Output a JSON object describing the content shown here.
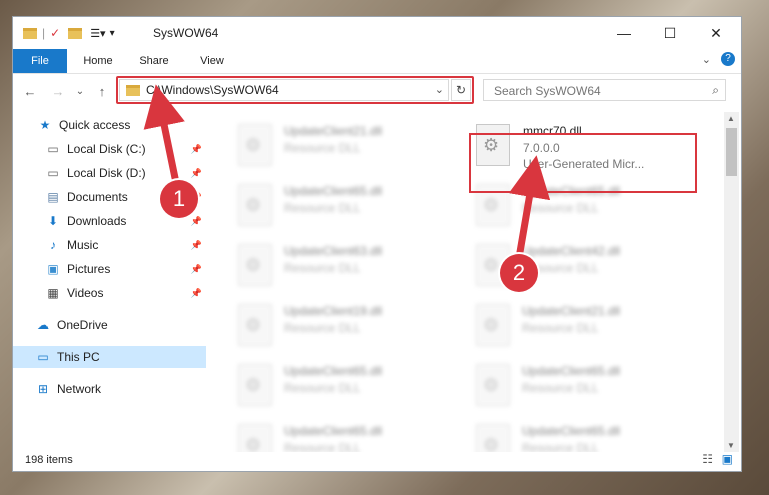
{
  "window": {
    "title": "SysWOW64",
    "minimize": "—",
    "maximize": "☐",
    "close": "✕"
  },
  "ribbon": {
    "tabs": [
      {
        "label": "File"
      },
      {
        "label": "Home"
      },
      {
        "label": "Share"
      },
      {
        "label": "View"
      }
    ]
  },
  "address": {
    "path": "C:\\Windows\\SysWOW64",
    "search_placeholder": "Search SysWOW64"
  },
  "nav": {
    "items": [
      {
        "label": "Quick access"
      },
      {
        "label": "Local Disk (C:)"
      },
      {
        "label": "Local Disk (D:)"
      },
      {
        "label": "Documents"
      },
      {
        "label": "Downloads"
      },
      {
        "label": "Music"
      },
      {
        "label": "Pictures"
      },
      {
        "label": "Videos"
      },
      {
        "label": "OneDrive"
      },
      {
        "label": "This PC"
      },
      {
        "label": "Network"
      }
    ]
  },
  "files": {
    "highlight": {
      "name": "mmcr70.dll",
      "version": "7.0.0.0",
      "type": "User-Generated Micr..."
    },
    "left": [
      {
        "name": "UpdateClient21.dll",
        "type": "Resource DLL"
      },
      {
        "name": "UpdateClient65.dll",
        "type": "Resource DLL"
      },
      {
        "name": "UpdateClient63.dll",
        "type": "Resource DLL"
      },
      {
        "name": "UpdateClient19.dll",
        "type": "Resource DLL"
      },
      {
        "name": "UpdateClient65.dll",
        "type": "Resource DLL"
      },
      {
        "name": "UpdateClient65.dll",
        "type": "Resource DLL"
      }
    ],
    "right": [
      {
        "name": "UpdateClient65.dll",
        "type": "Resource DLL"
      },
      {
        "name": "UpdateClient42.dll",
        "type": "Resource DLL"
      },
      {
        "name": "UpdateClient21.dll",
        "type": "Resource DLL"
      },
      {
        "name": "UpdateClient65.dll",
        "type": "Resource DLL"
      },
      {
        "name": "UpdateClient65.dll",
        "type": "Resource DLL"
      }
    ]
  },
  "status": {
    "count": "198 items"
  },
  "markers": {
    "one": "1",
    "two": "2"
  },
  "colors": {
    "accent": "#1979ca",
    "highlight": "#d9363e",
    "selected": "#cce8ff"
  }
}
